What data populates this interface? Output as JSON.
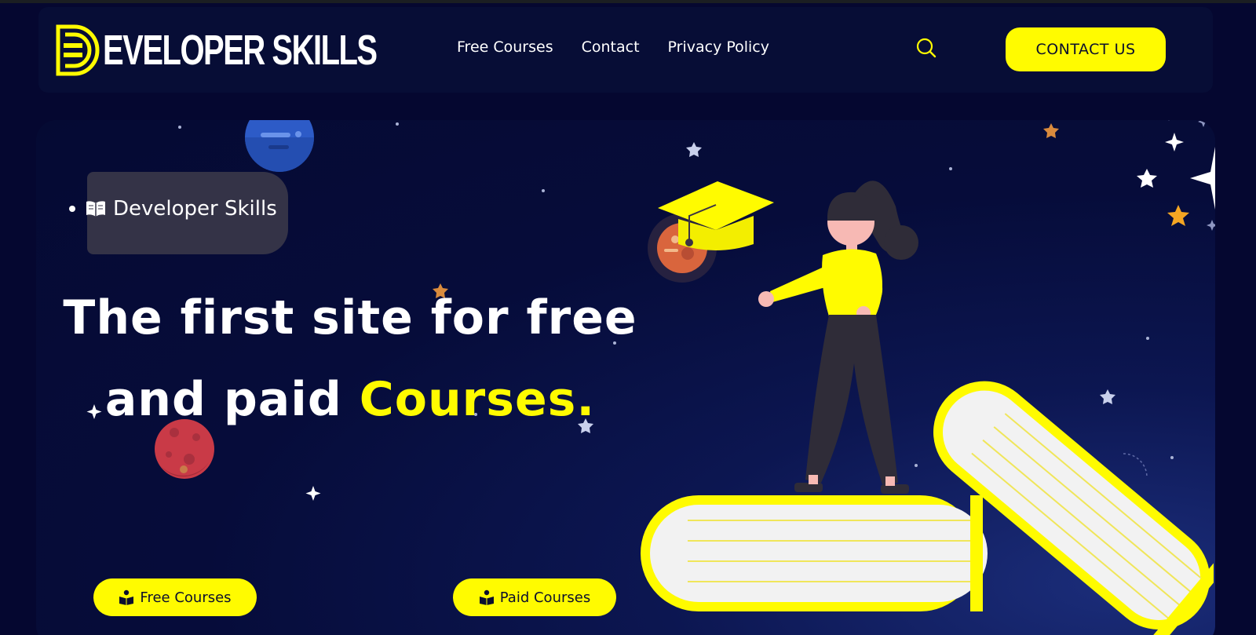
{
  "brand": {
    "logo_text": "EVELOPER SKILLS",
    "logo_letter": "D",
    "icon": "developer-skills-logo"
  },
  "nav": {
    "links": [
      {
        "label": "Free Courses"
      },
      {
        "label": "Contact"
      },
      {
        "label": "Privacy Policy"
      }
    ],
    "search_icon": "search-icon",
    "contact_button": "CONTACT US"
  },
  "hero": {
    "badge": {
      "text": "Developer Skills",
      "icon": "open-book-icon"
    },
    "headline_line1": "The first site for free",
    "headline_line2_prefix": "and paid ",
    "headline_line2_accent": "Courses.",
    "buttons": [
      {
        "label": "Free Courses",
        "icon": "reader-icon"
      },
      {
        "label": "Paid Courses",
        "icon": "reader-icon"
      }
    ]
  },
  "colors": {
    "accent": "#fffb00",
    "background": "#050730",
    "hero_bg": "#060c3a",
    "badge_bg": "#343347"
  }
}
